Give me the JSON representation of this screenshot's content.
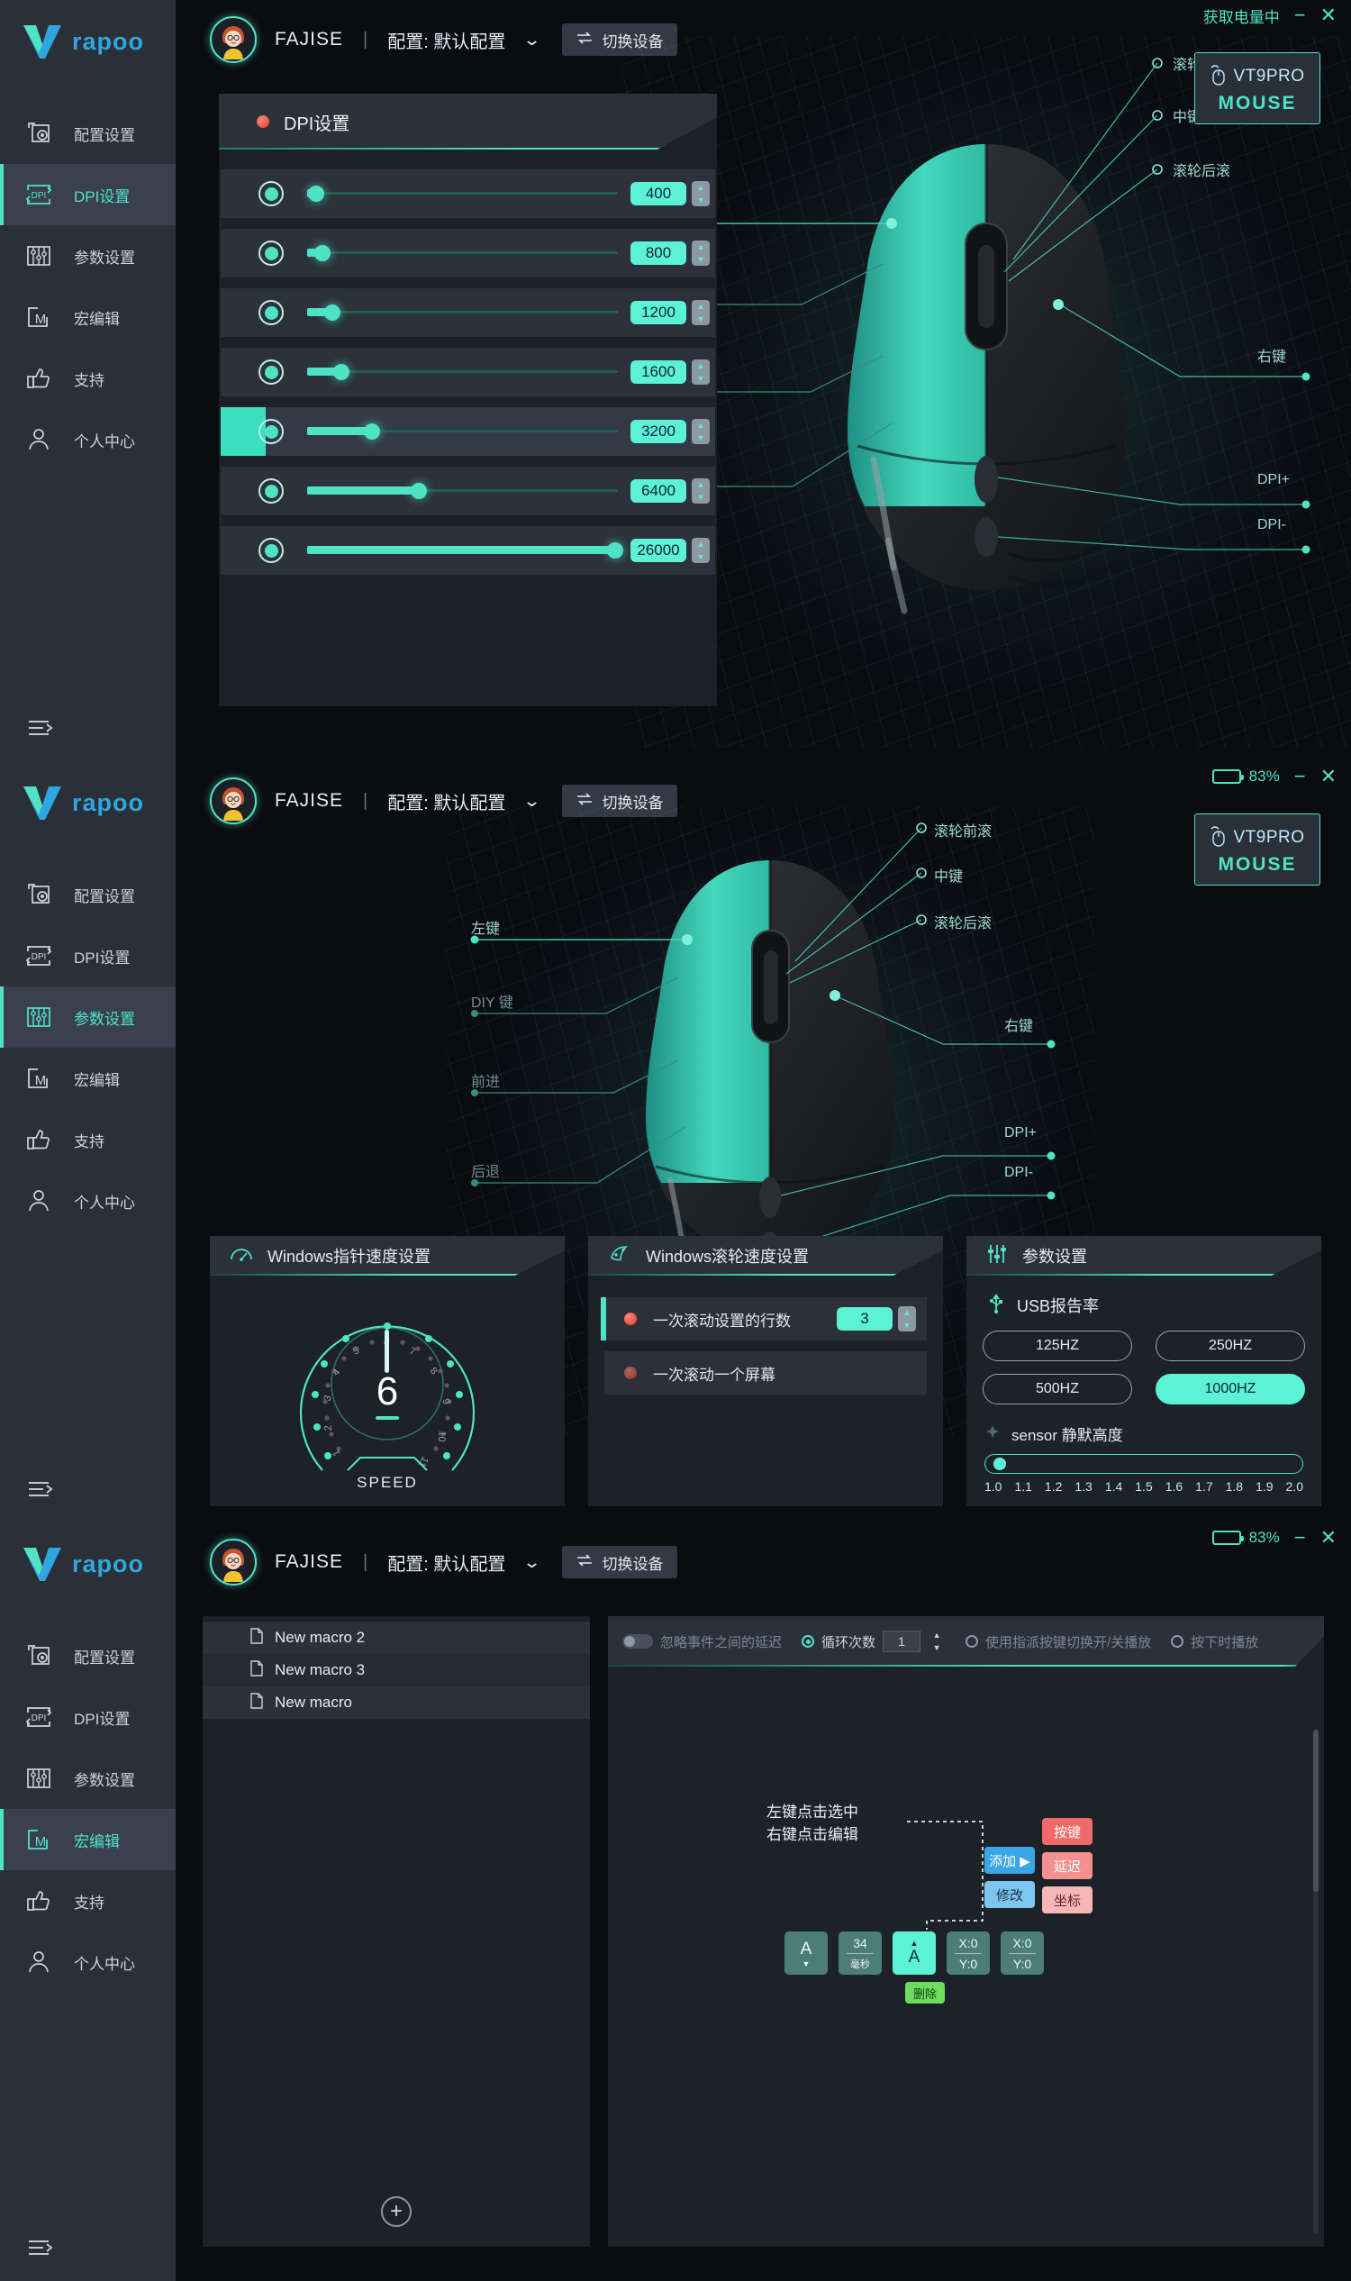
{
  "brand": {
    "name": "rapoo"
  },
  "sidebar": {
    "items": [
      {
        "label": "配置设置",
        "icon": "profile-settings-icon"
      },
      {
        "label": "DPI设置",
        "icon": "dpi-icon"
      },
      {
        "label": "参数设置",
        "icon": "parameters-icon"
      },
      {
        "label": "宏编辑",
        "icon": "macro-icon"
      },
      {
        "label": "支持",
        "icon": "thumbs-up-icon"
      },
      {
        "label": "个人中心",
        "icon": "user-icon"
      }
    ],
    "collapse_icon": "collapse-menu-icon"
  },
  "header": {
    "username": "FAJISE",
    "separator": "|",
    "profile_label": "配置: 默认配置",
    "switch_device": "切换设备",
    "caret": "chevron-down-icon"
  },
  "titlebar": {
    "status_text": "获取电量中",
    "battery_percent": "83%",
    "battery_level": 83,
    "minimize": "−",
    "close": "✕"
  },
  "device_badge": {
    "name": "VT9PRO",
    "sub": "MOUSE"
  },
  "dpi_panel": {
    "title": "DPI设置",
    "rows": [
      {
        "value": "400",
        "fill_pct": 3,
        "selected": false
      },
      {
        "value": "800",
        "fill_pct": 5,
        "selected": false
      },
      {
        "value": "1200",
        "fill_pct": 7,
        "selected": false
      },
      {
        "value": "1600",
        "fill_pct": 10,
        "selected": false
      },
      {
        "value": "3200",
        "fill_pct": 20,
        "selected": true
      },
      {
        "value": "6400",
        "fill_pct": 34,
        "selected": false
      },
      {
        "value": "26000",
        "fill_pct": 98,
        "selected": false
      }
    ],
    "spinner_up": "▲",
    "spinner_down": "▼"
  },
  "mouse_labels": {
    "left": [
      {
        "text": "左键",
        "bright": true
      },
      {
        "text": "DIY 键",
        "bright": false
      },
      {
        "text": "前进",
        "bright": false
      },
      {
        "text": "后退",
        "bright": false
      }
    ],
    "right": [
      {
        "text": "滚轮前滚"
      },
      {
        "text": "中键"
      },
      {
        "text": "滚轮后滚"
      },
      {
        "text": "右键"
      },
      {
        "text": "DPI+"
      },
      {
        "text": "DPI-"
      }
    ]
  },
  "pointer_card": {
    "title": "Windows指针速度设置",
    "icon": "speedometer-icon",
    "value": "6",
    "speed_label": "SPEED",
    "ticks": [
      "1",
      "2",
      "3",
      "4",
      "5",
      "6",
      "7",
      "8",
      "9",
      "10",
      "11"
    ]
  },
  "scroll_card": {
    "title": "Windows滚轮速度设置",
    "icon": "scroll-icon",
    "rows": [
      {
        "label": "一次滚动设置的行数",
        "value": "3",
        "has_spinner": true,
        "active": true
      },
      {
        "label": "一次滚动一个屏幕",
        "value": "",
        "has_spinner": false,
        "active": false
      }
    ]
  },
  "param_card": {
    "title": "参数设置",
    "icon": "sliders-icon",
    "usb_label": "USB报告率",
    "usb_icon": "usb-icon",
    "rates": [
      {
        "label": "125HZ",
        "selected": false
      },
      {
        "label": "250HZ",
        "selected": false
      },
      {
        "label": "500HZ",
        "selected": false
      },
      {
        "label": "1000HZ",
        "selected": true
      }
    ],
    "sensor_label": "sensor 静默高度",
    "sensor_icon": "sensor-icon",
    "sensor_value": 1.0,
    "sensor_ticks": [
      "1.0",
      "1.1",
      "1.2",
      "1.3",
      "1.4",
      "1.5",
      "1.6",
      "1.7",
      "1.8",
      "1.9",
      "2.0"
    ]
  },
  "macro": {
    "list": [
      {
        "label": "New macro 2",
        "icon": "file-icon"
      },
      {
        "label": "New macro 3",
        "icon": "file-icon"
      },
      {
        "label": "New macro",
        "icon": "file-icon"
      }
    ],
    "add_label": "+",
    "toolbar": {
      "ignore_delay": "忽略事件之间的延迟",
      "loop_count": "循环次数",
      "loop_value": "1",
      "toggle_play": "使用指派按键切换开/关播放",
      "press_play": "按下时播放"
    },
    "hint_line1": "左键点击选中",
    "hint_line2": "右键点击编辑",
    "context_menu": [
      {
        "label": "添加 ▶",
        "style": "blue1"
      },
      {
        "label": "修改",
        "style": "blue2"
      }
    ],
    "context_types": [
      {
        "label": "按键",
        "style": "red1"
      },
      {
        "label": "延迟",
        "style": "red2"
      },
      {
        "label": "坐标",
        "style": "red3"
      }
    ],
    "delete_label": "删除",
    "events": [
      {
        "kind": "key",
        "main": "A",
        "arrow": "▼",
        "highlight": false
      },
      {
        "kind": "delay",
        "top": "34",
        "bottom": "毫秒",
        "highlight": false
      },
      {
        "kind": "key",
        "main": "A",
        "arrow": "▲",
        "highlight": true
      },
      {
        "kind": "coord",
        "top": "X:0",
        "bottom": "Y:0",
        "highlight": false
      },
      {
        "kind": "coord",
        "top": "X:0",
        "bottom": "Y:0",
        "highlight": false
      }
    ]
  },
  "colors": {
    "accent": "#4fe3c6",
    "accent_bright": "#5cf2d6",
    "sidebar_bg": "#2b2f38",
    "panel_bg": "#1c2028",
    "row_bg": "#2c313b",
    "logo_blue": "#2ea7e0",
    "red_dot": "#e0392b"
  }
}
